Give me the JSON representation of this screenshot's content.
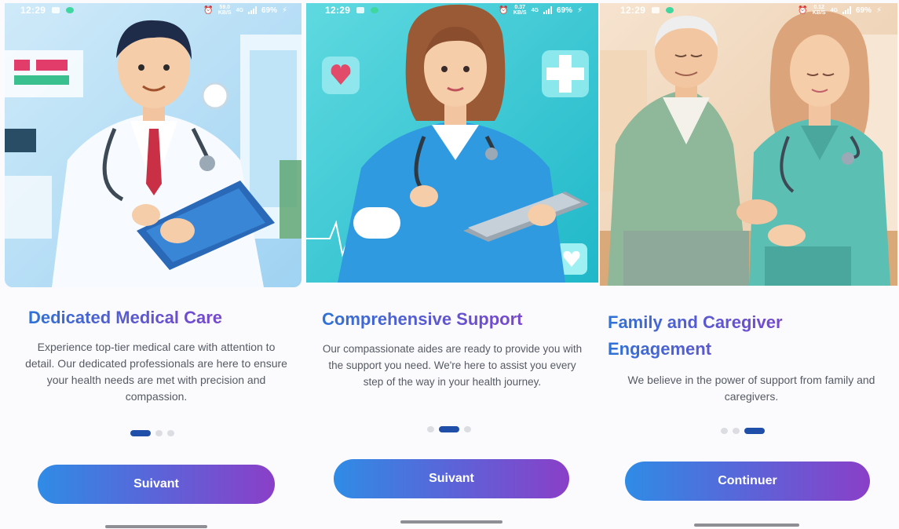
{
  "colors": {
    "title_gradient": [
      "#2f72d6",
      "#8a3fc9"
    ],
    "button_gradient": [
      "#2f8ce6",
      "#8a3fc8"
    ],
    "dot_active": "#1f4fa8",
    "dot_inactive": "#dcdde2"
  },
  "screens": [
    {
      "status": {
        "time": "12:29",
        "net_speed_top": "59.0",
        "net_speed_unit": "KB/S",
        "net_type": "4G",
        "battery": "69%"
      },
      "illustration": "doctor-with-clipboard",
      "title": "Dedicated Medical Care",
      "description": "Experience top-tier medical care with attention to detail. Our dedicated professionals are here to ensure your health needs are met with precision and compassion.",
      "page_indicator": {
        "count": 3,
        "active": 0
      },
      "button_label": "Suivant"
    },
    {
      "status": {
        "time": "12:29",
        "net_speed_top": "0.37",
        "net_speed_unit": "KB/S",
        "net_type": "4G",
        "battery": "69%"
      },
      "illustration": "nurse-with-tablet",
      "title": "Comprehensive Support",
      "description": "Our compassionate aides are ready to provide you with the support you need. We're here to assist you every step of the way in your health journey.",
      "page_indicator": {
        "count": 3,
        "active": 1
      },
      "button_label": "Suivant"
    },
    {
      "status": {
        "time": "12:29",
        "net_speed_top": "0.12",
        "net_speed_unit": "KB/S",
        "net_type": "4G",
        "battery": "69%"
      },
      "illustration": "caregiver-with-elderly-man",
      "title": "Family and Caregiver Engagement",
      "description": "We believe in the power of support from family and caregivers.",
      "page_indicator": {
        "count": 3,
        "active": 2
      },
      "button_label": "Continuer"
    }
  ]
}
